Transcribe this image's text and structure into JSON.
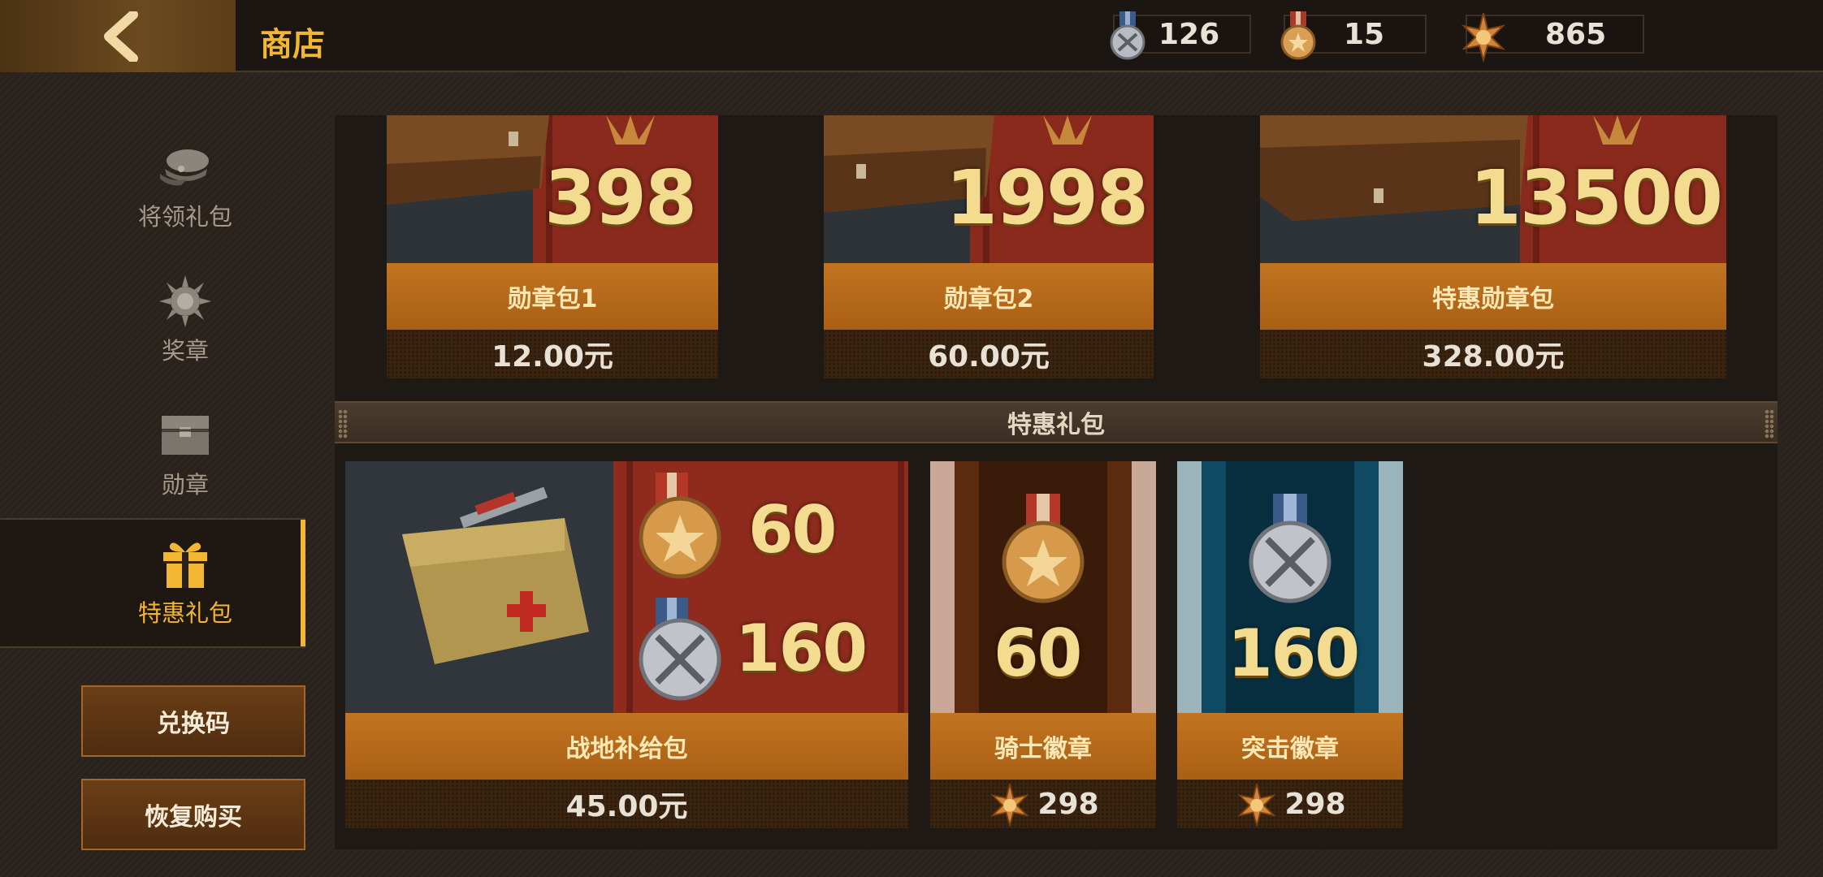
{
  "header": {
    "title": "商店",
    "currencies": [
      {
        "icon": "silver-medal-icon",
        "value": "126"
      },
      {
        "icon": "bronze-medal-icon",
        "value": "15"
      },
      {
        "icon": "star-badge-icon",
        "value": "865"
      }
    ]
  },
  "sidebar": {
    "items": [
      {
        "icon": "officer-cap-icon",
        "label": "将领礼包"
      },
      {
        "icon": "sun-medal-icon",
        "label": "奖章"
      },
      {
        "icon": "chest-icon",
        "label": "勋章"
      },
      {
        "icon": "gift-icon",
        "label": "特惠礼包",
        "active": true
      }
    ],
    "redeem_label": "兑换码",
    "restore_label": "恢复购买"
  },
  "medal_packs": [
    {
      "amount": "398",
      "name": "勋章包1",
      "price": "12.00元"
    },
    {
      "amount": "1998",
      "name": "勋章包2",
      "price": "60.00元"
    },
    {
      "amount": "13500",
      "name": "特惠勋章包",
      "price": "328.00元"
    }
  ],
  "section_title": "特惠礼包",
  "special_packs": [
    {
      "name": "战地补给包",
      "price": "45.00元",
      "amounts": [
        "60",
        "160"
      ]
    },
    {
      "name": "骑士徽章",
      "price": "298",
      "amount": "60"
    },
    {
      "name": "突击徽章",
      "price": "298",
      "amount": "160"
    }
  ],
  "colors": {
    "accent": "#f2b632",
    "name_band": "#c27420",
    "panel": "#1f1915"
  }
}
